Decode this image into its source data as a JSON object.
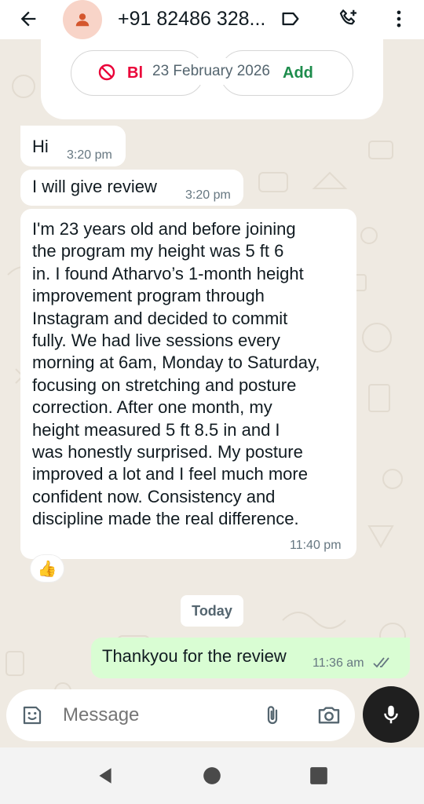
{
  "header": {
    "contact_name": "+91 82486 328...",
    "back_icon": "arrow-left-icon",
    "label_icon": "label-icon",
    "call_icon": "add-call-icon",
    "menu_icon": "more-vert-icon"
  },
  "top_card": {
    "block_label": "Bl",
    "add_label": "Add",
    "date_chip": "23 February 2026"
  },
  "messages": [
    {
      "direction": "in",
      "text": "Hi",
      "time": "3:20 pm"
    },
    {
      "direction": "in",
      "text": "I will give review",
      "time": "3:20 pm"
    },
    {
      "direction": "in",
      "lines": [
        "I'm 23 years old and before joining",
        "the program my height was 5 ft 6",
        "in. I found Atharvo’s 1-month height",
        "improvement program through",
        "Instagram and decided to commit",
        "fully. We had live sessions every",
        "morning at 6am, Monday to Saturday,",
        "focusing on stretching and posture",
        "correction. After one month, my",
        "height measured 5 ft 8.5 in and I",
        "was honestly surprised. My posture",
        "improved a lot and I feel much more",
        "confident now. Consistency and",
        "discipline made the real difference."
      ],
      "time": "11:40 pm",
      "reaction": "👍"
    },
    {
      "direction": "out",
      "text": "Thankyou for the review",
      "time": "11:36 am",
      "status": "read"
    }
  ],
  "today_chip": "Today",
  "composer": {
    "placeholder": "Message",
    "emoji_icon": "sticker-icon",
    "attach_icon": "paperclip-icon",
    "camera_icon": "camera-icon",
    "mic_icon": "microphone-icon"
  },
  "nav": {
    "back": "triangle-back-icon",
    "home": "circle-home-icon",
    "recents": "square-recents-icon"
  },
  "colors": {
    "accent_green": "#1d8c4c",
    "block_red": "#ea0038",
    "outgoing_bubble": "#d9fdd3",
    "chat_bg": "#efeae2"
  }
}
